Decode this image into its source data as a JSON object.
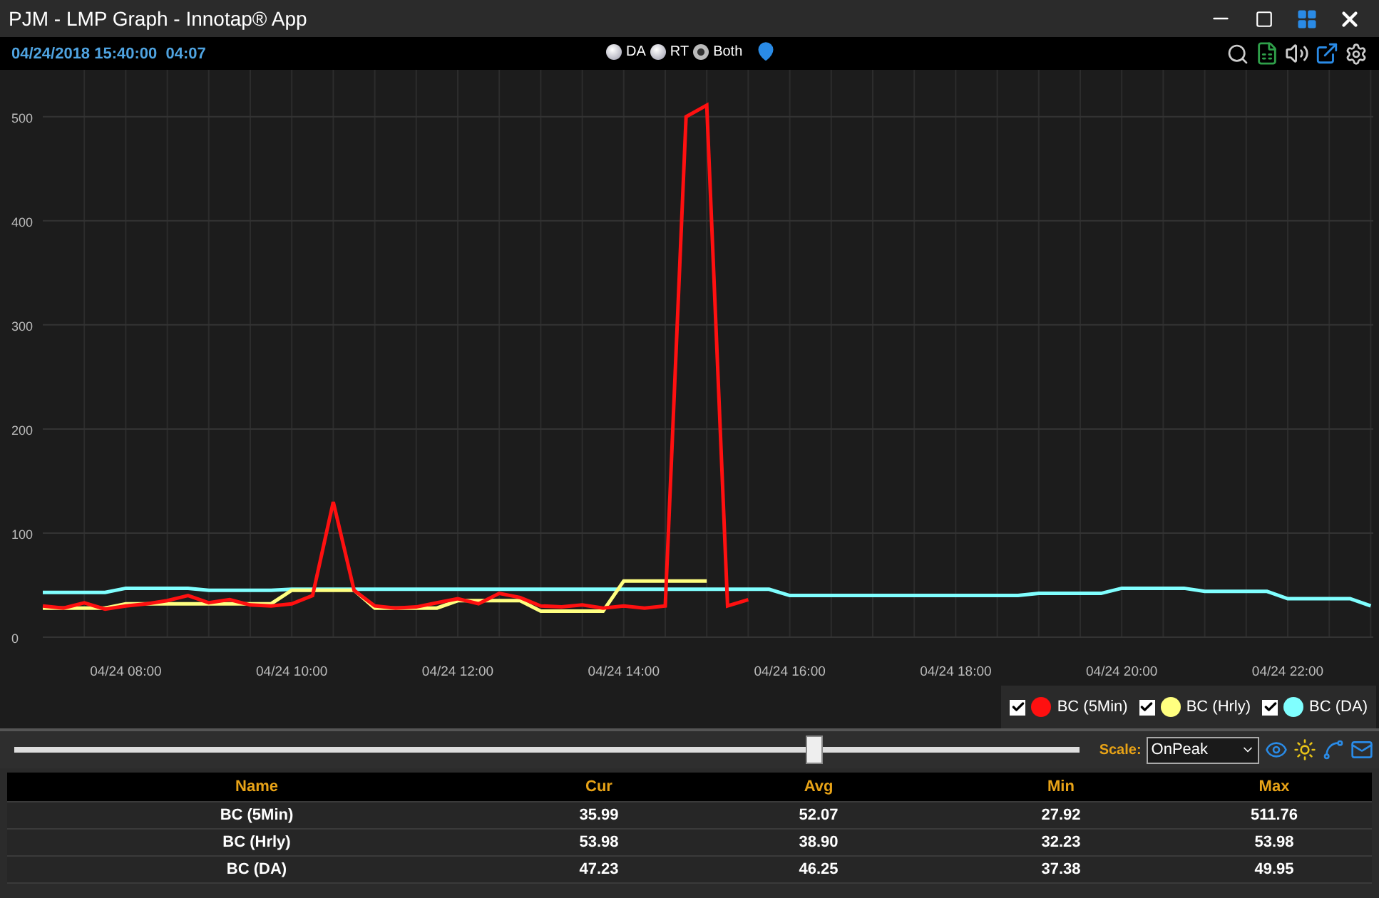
{
  "window": {
    "title": "PJM - LMP Graph - Innotap® App"
  },
  "toolbar": {
    "timestamp": "04/24/2018 15:40:00",
    "time": "04:07",
    "modes": [
      {
        "label": "DA",
        "selected": false
      },
      {
        "label": "RT",
        "selected": false
      },
      {
        "label": "Both",
        "selected": true
      }
    ]
  },
  "chart": {
    "chart_data": {
      "type": "line",
      "categories": [
        null,
        null,
        null,
        null,
        "04/24 08:00",
        null,
        null,
        null,
        null,
        null,
        null,
        null,
        "04/24 10:00",
        null,
        null,
        null,
        null,
        null,
        null,
        null,
        "04/24 12:00",
        null,
        null,
        null,
        null,
        null,
        null,
        null,
        "04/24 14:00",
        null,
        null,
        null,
        null,
        null,
        null,
        null,
        "04/24 16:00",
        null,
        null,
        null,
        null,
        null,
        null,
        null,
        "04/24 18:00",
        null,
        null,
        null,
        null,
        null,
        null,
        null,
        "04/24 20:00",
        null,
        null,
        null,
        null,
        null,
        null,
        null,
        "04/24 22:00",
        null,
        null,
        null,
        null
      ],
      "ylim": [
        0,
        545
      ],
      "grid": true,
      "yticks": [
        0,
        100,
        200,
        300,
        400,
        500
      ],
      "series": [
        {
          "name": "BC (5Min)",
          "color": "#ff1010",
          "values": [
            30,
            28,
            33,
            27,
            30,
            32,
            35,
            40,
            33,
            36,
            31,
            30,
            32,
            40,
            130,
            45,
            30,
            28,
            29,
            33,
            37,
            32,
            42,
            38,
            30,
            29,
            31,
            28,
            30,
            28,
            30,
            500,
            511,
            30,
            36,
            null,
            null,
            null,
            null,
            null,
            null,
            null,
            null,
            null,
            null,
            null,
            null,
            null,
            null,
            null,
            null,
            null,
            null,
            null,
            null,
            null,
            null,
            null,
            null,
            null,
            null,
            null,
            null,
            null,
            null
          ]
        },
        {
          "name": "BC (Hrly)",
          "color": "#ffff80",
          "values": [
            28,
            28,
            28,
            28,
            32,
            32,
            32,
            32,
            32,
            32,
            32,
            32,
            45,
            45,
            45,
            45,
            28,
            28,
            28,
            28,
            35,
            35,
            35,
            35,
            25,
            25,
            25,
            25,
            54,
            54,
            54,
            54,
            54,
            null,
            null,
            null,
            null,
            null,
            null,
            null,
            null,
            null,
            null,
            null,
            null,
            null,
            null,
            null,
            null,
            null,
            null,
            null,
            null,
            null,
            null,
            null,
            null,
            null,
            null,
            null,
            null,
            null,
            null,
            null,
            null
          ]
        },
        {
          "name": "BC (DA)",
          "color": "#80ffff",
          "values": [
            43,
            43,
            43,
            43,
            47,
            47,
            47,
            47,
            45,
            45,
            45,
            45,
            46,
            46,
            46,
            46,
            46,
            46,
            46,
            46,
            46,
            46,
            46,
            46,
            46,
            46,
            46,
            46,
            46,
            46,
            46,
            46,
            46,
            46,
            46,
            46,
            40,
            40,
            40,
            40,
            40,
            40,
            40,
            40,
            40,
            40,
            40,
            40,
            42,
            42,
            42,
            42,
            47,
            47,
            47,
            47,
            44,
            44,
            44,
            44,
            37,
            37,
            37,
            37,
            30
          ]
        }
      ]
    },
    "legend": [
      {
        "checked": true
      },
      {
        "checked": true
      },
      {
        "checked": true
      }
    ]
  },
  "controls": {
    "slider": {
      "level": 0.75
    },
    "scale_label": "Scale:",
    "scale_value": "OnPeak"
  },
  "table": {
    "columns": [
      "Name",
      "Cur",
      "Avg",
      "Min",
      "Max"
    ],
    "rows": [
      [
        "BC (5Min)",
        "35.99",
        "52.07",
        "27.92",
        "511.76"
      ],
      [
        "BC (Hrly)",
        "53.98",
        "38.90",
        "32.23",
        "53.98"
      ],
      [
        "BC (DA)",
        "47.23",
        "46.25",
        "37.38",
        "49.95"
      ]
    ]
  }
}
